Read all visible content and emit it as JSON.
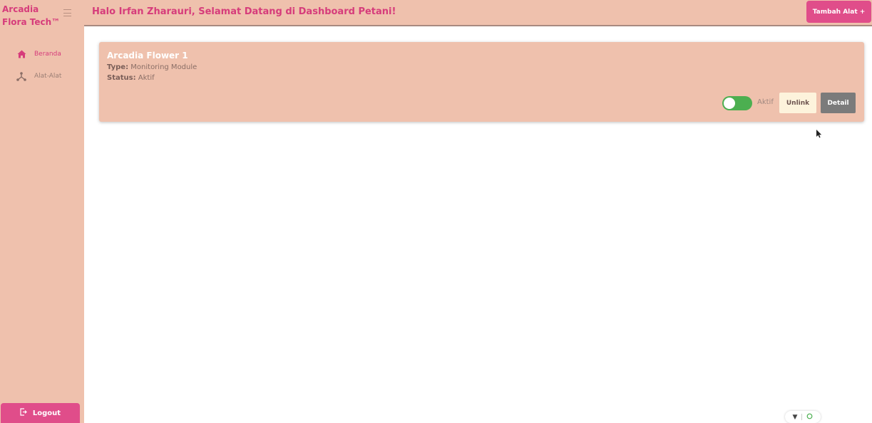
{
  "app": {
    "brand": "Arcadia Flora Tech™"
  },
  "sidebar": {
    "items": [
      {
        "label": "Beranda",
        "icon": "home-icon"
      },
      {
        "label": "Alat-Alat",
        "icon": "hub-icon"
      }
    ],
    "logout_label": "Logout"
  },
  "header": {
    "greeting": "Halo Irfan Zharauri, Selamat Datang di Dashboard Petani!",
    "add_button": "Tambah Alat +"
  },
  "device": {
    "name": "Arcadia Flower 1",
    "type_label": "Type:",
    "type_value": "Monitoring Module",
    "status_label": "Status:",
    "status_value": "Aktif",
    "toggle_label": "Aktif",
    "toggle_on": true,
    "unlink_label": "Unlink",
    "detail_label": "Detail"
  },
  "colors": {
    "accent": "#d63c7b",
    "button_pink": "#e04d8a",
    "panel": "#efc1ad",
    "toggle_on": "#4caf50"
  }
}
